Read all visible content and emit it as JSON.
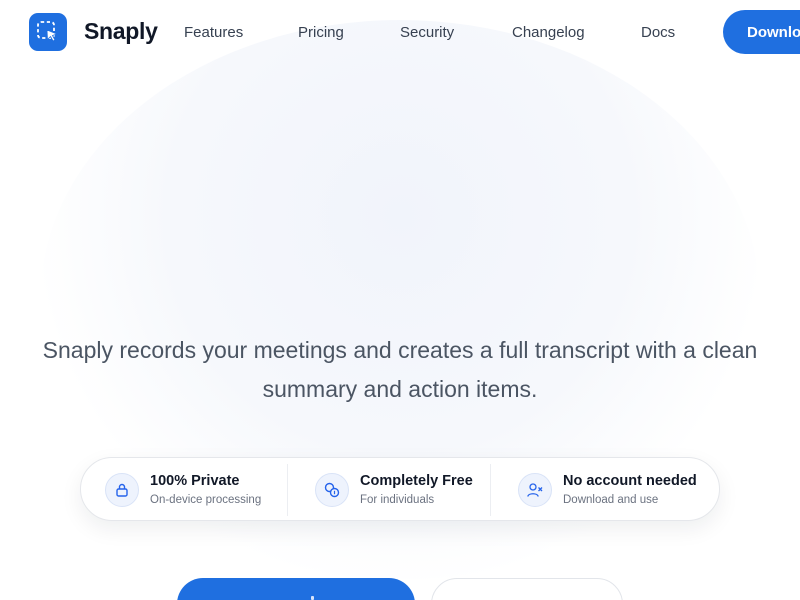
{
  "header": {
    "brand": "Snaply",
    "logo_icon": "selection-cursor-icon",
    "nav": [
      "Features",
      "Pricing",
      "Security",
      "Changelog",
      "Docs"
    ],
    "download_label": "Download"
  },
  "hero": {
    "tagline": "Snaply records your meetings and creates a full transcript with a clean summary and action items."
  },
  "features": [
    {
      "icon": "lock-icon",
      "title": "100% Private",
      "subtitle": "On-device processing"
    },
    {
      "icon": "coins-icon",
      "title": "Completely Free",
      "subtitle": "For individuals"
    },
    {
      "icon": "user-x-icon",
      "title": "No account needed",
      "subtitle": "Download and use"
    }
  ],
  "colors": {
    "accent": "#1f6fe0",
    "text_dark": "#111827",
    "text_muted": "#6b7280"
  }
}
